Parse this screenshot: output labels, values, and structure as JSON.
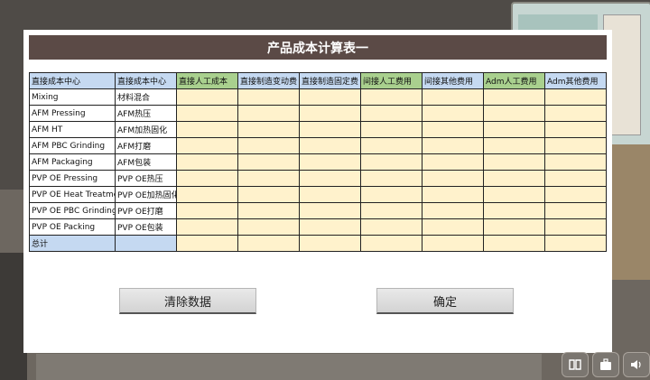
{
  "dialog": {
    "title": "产品成本计算表一"
  },
  "table": {
    "headers": [
      {
        "label": "直接成本中心",
        "style": "blue"
      },
      {
        "label": "直接成本中心",
        "style": "blue"
      },
      {
        "label": "直接人工成本",
        "style": "green"
      },
      {
        "label": "直接制造变动费",
        "style": "blue"
      },
      {
        "label": "直接制造固定费",
        "style": "blue"
      },
      {
        "label": "间接人工费用",
        "style": "green"
      },
      {
        "label": "间接其他费用",
        "style": "blue"
      },
      {
        "label": "Adm人工费用",
        "style": "green"
      },
      {
        "label": "Adm其他费用",
        "style": "blue"
      }
    ],
    "rows": [
      {
        "en": "Mixing",
        "cn": "材料混合"
      },
      {
        "en": "AFM Pressing",
        "cn": "AFM热压"
      },
      {
        "en": "AFM HT",
        "cn": "AFM加热固化"
      },
      {
        "en": "AFM PBC Grinding",
        "cn": "AFM打磨"
      },
      {
        "en": "AFM Packaging",
        "cn": "AFM包装"
      },
      {
        "en": "PVP OE Pressing",
        "cn": "PVP OE热压"
      },
      {
        "en": "PVP OE Heat Treatment",
        "cn": "PVP OE加热固化"
      },
      {
        "en": "PVP OE PBC Grinding",
        "cn": "PVP OE打磨"
      },
      {
        "en": "PVP OE Packing",
        "cn": "PVP OE包装"
      }
    ],
    "total_label": "总计",
    "input_columns": 7
  },
  "buttons": {
    "clear": "清除数据",
    "confirm": "确定"
  },
  "colors": {
    "header_bar": "#5b4a46",
    "header_blue": "#c5d9f1",
    "header_green": "#a9d08e",
    "input_cell": "#fff2cc"
  },
  "icons": [
    "book-icon",
    "briefcase-icon",
    "speaker-icon"
  ]
}
